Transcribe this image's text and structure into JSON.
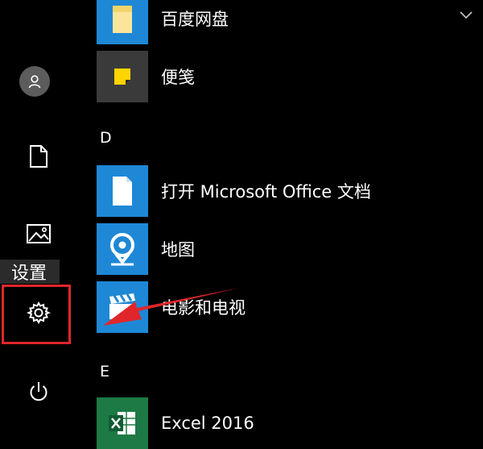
{
  "rail": {
    "tooltip": "设置",
    "icons": [
      "user-icon",
      "document-icon",
      "picture-icon",
      "gear-icon",
      "power-icon"
    ]
  },
  "apps": {
    "items": [
      {
        "label": "百度网盘",
        "icon": "folder-icon",
        "tile_color": "#1e88d6"
      },
      {
        "label": "便笺",
        "icon": "sticky-note-icon",
        "tile_color": "#3a3a3a"
      },
      {
        "label": "打开 Microsoft Office 文档",
        "icon": "document-icon",
        "tile_color": "#1e88d6"
      },
      {
        "label": "地图",
        "icon": "map-pin-icon",
        "tile_color": "#1e88d6"
      },
      {
        "label": "电影和电视",
        "icon": "clapperboard-icon",
        "tile_color": "#1e88d6"
      },
      {
        "label": "Excel 2016",
        "icon": "excel-icon",
        "tile_color": "#1d7a45"
      }
    ]
  },
  "sections": {
    "d": "D",
    "e": "E"
  },
  "annotation": {
    "highlight_color": "#e0262b"
  }
}
